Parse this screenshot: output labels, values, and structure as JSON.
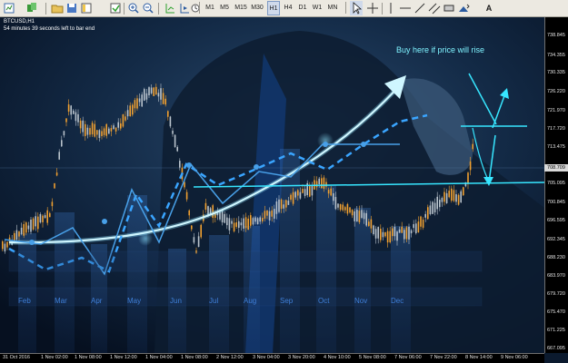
{
  "toolbar": {
    "timeframes": [
      "M1",
      "M5",
      "M15",
      "M30",
      "H1",
      "H4",
      "D1",
      "W1",
      "MN"
    ],
    "active_timeframe": "H1",
    "text_tool": "A"
  },
  "chart": {
    "symbol": "BTCUSD,H1",
    "bar_timer": "54 minutes 39 seconds left to bar end",
    "headline": "Buy here if price will rise",
    "current_price": "708.709",
    "price_scale": [
      "738.845",
      "734.355",
      "730.335",
      "726.220",
      "721.970",
      "717.720",
      "713.475",
      "708.709",
      "705.095",
      "700.845",
      "696.595",
      "692.345",
      "688.230",
      "683.970",
      "679.720",
      "675.470",
      "671.225",
      "667.095"
    ],
    "time_scale": [
      "31 Oct 2016",
      "1 Nov 02:00",
      "1 Nov 08:00",
      "1 Nov 12:00",
      "1 Nov 04:00",
      "1 Nov 08:00",
      "2 Nov 12:00",
      "3 Nov 04:00",
      "3 Nov 20:00",
      "4 Nov 10:00",
      "5 Nov 08:00",
      "7 Nov 06:00",
      "7 Nov 22:00",
      "8 Nov 14:00",
      "9 Nov 06:00"
    ],
    "background_months": [
      "Feb",
      "Mar",
      "Apr",
      "May",
      "Jun",
      "Jul",
      "Aug",
      "Sep",
      "Oct",
      "Nov",
      "Dec"
    ]
  },
  "colors": {
    "bull_candle": "#f0a030",
    "bear_candle": "#b9c3cc",
    "trend_line": "#38c9ff",
    "annotation": "#37e6ff"
  },
  "icons": [
    "new-chart-icon",
    "profiles-icon",
    "open-folder-icon",
    "save-icon",
    "navigator-icon",
    "autotrading-icon",
    "zoom-in-icon",
    "zoom-out-icon",
    "chart-shift-icon",
    "autoscroll-icon",
    "period-icon",
    "cursor-icon",
    "crosshair-icon",
    "vertical-line-icon",
    "horizontal-line-icon",
    "trendline-icon",
    "channel-icon",
    "rectangle-icon",
    "arrows-icon",
    "text-icon"
  ]
}
